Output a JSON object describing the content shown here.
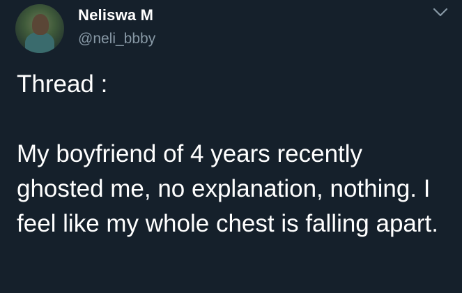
{
  "tweet": {
    "author": {
      "name": "Neliswa M",
      "handle": "@neli_bbby",
      "avatar_icon": "profile-photo"
    },
    "menu_icon": "chevron-down-icon",
    "text": "Thread :\n\nMy boyfriend of 4 years recently ghosted me, no explanation, nothing. I feel like my whole chest is falling apart."
  },
  "colors": {
    "background": "#15202b",
    "text": "#ffffff",
    "secondary": "#8899a6"
  }
}
